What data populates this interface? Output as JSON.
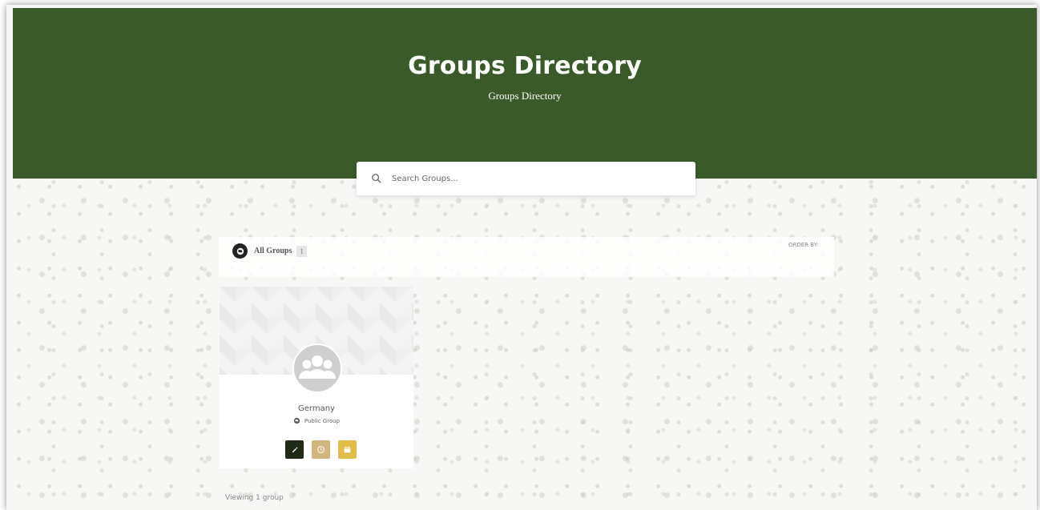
{
  "header": {
    "title": "Groups Directory",
    "subtitle": "Groups Directory"
  },
  "search": {
    "placeholder": "Search Groups...",
    "icon": "search-icon"
  },
  "filters": {
    "tab_label": "All Groups",
    "tab_count": "1",
    "order_by_label": "ORDER BY:"
  },
  "groups": [
    {
      "name": "Germany",
      "type": "Public Group",
      "actions": [
        {
          "icon": "pencil-icon",
          "color": "#1f2a17"
        },
        {
          "icon": "clock-icon",
          "color": "#d1b77f"
        },
        {
          "icon": "calendar-icon",
          "color": "#e3bd4a"
        }
      ]
    }
  ],
  "footer": {
    "viewing_text": "Viewing 1 group"
  },
  "colors": {
    "header_bg": "#3a5a2a",
    "page_bg": "#f7f7f5"
  }
}
